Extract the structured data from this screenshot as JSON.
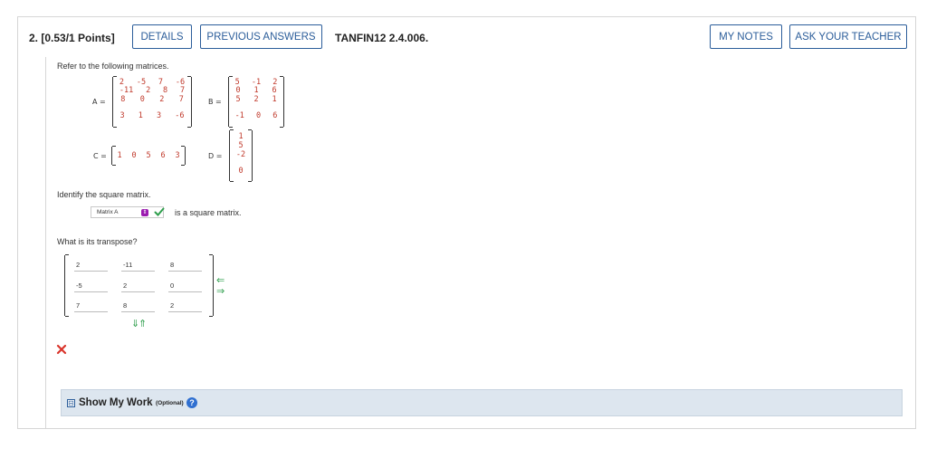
{
  "header": {
    "question_title": "2. [0.53/1 Points]",
    "details_label": "DETAILS",
    "previous_answers_label": "PREVIOUS ANSWERS",
    "question_code": "TANFIN12 2.4.006.",
    "my_notes_label": "MY NOTES",
    "ask_teacher_label": "ASK YOUR TEACHER"
  },
  "problem": {
    "intro": "Refer to the following matrices.",
    "matrix_a_label": "A =",
    "matrix_a": [
      [
        "2",
        "-5",
        "7",
        "-6"
      ],
      [
        "-11",
        "2",
        "8",
        "7"
      ],
      [
        "8",
        "0",
        "2",
        "7"
      ],
      [
        "3",
        "1",
        "3",
        "-6"
      ]
    ],
    "matrix_b_label": "B =",
    "matrix_b": [
      [
        "5",
        "-1",
        "2"
      ],
      [
        "0",
        "1",
        "6"
      ],
      [
        "5",
        "2",
        "1"
      ],
      [
        "-1",
        "0",
        "6"
      ]
    ],
    "matrix_c_label": "C =",
    "matrix_c": [
      [
        "1",
        "0",
        "5",
        "6",
        "3"
      ]
    ],
    "matrix_d_label": "D =",
    "matrix_d": [
      [
        "1"
      ],
      [
        "5"
      ],
      [
        "-2"
      ],
      [
        "0"
      ]
    ],
    "identify_prompt": "Identify the square matrix.",
    "square_select_value": "Matrix A",
    "square_suffix": "is a square matrix.",
    "transpose_prompt": "What is its transpose?",
    "transpose_cells": [
      [
        "2",
        "-11",
        "8"
      ],
      [
        "-5",
        "2",
        "0"
      ],
      [
        "7",
        "8",
        "2"
      ]
    ]
  },
  "show_work": {
    "toggle_symbol": "⊟",
    "label": "Show My Work",
    "optional": "(Optional)",
    "help": "?"
  },
  "colors": {
    "accent_blue": "#2b5d9a",
    "correct_green": "#2e9e4c",
    "wrong_red": "#d9342b",
    "matrix_red": "#c0392b",
    "select_purple": "#9b1bb0"
  }
}
